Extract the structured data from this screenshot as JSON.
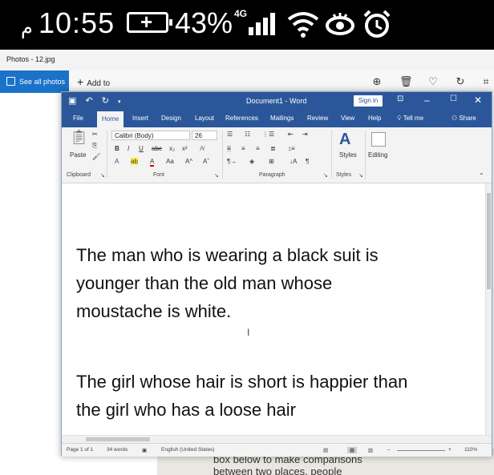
{
  "status_bar": {
    "ampm": "م",
    "time": "10:55",
    "battery_percent": "43%",
    "network": "4G"
  },
  "photos": {
    "title": "Photos - 12.jpg",
    "see_all_label": "See all photos",
    "add_to_label": "Add to"
  },
  "word": {
    "doc_title": "Document1 - Word",
    "sign_in": "Sign in",
    "tabs": [
      "File",
      "Home",
      "Insert",
      "Design",
      "Layout",
      "References",
      "Mailings",
      "Review",
      "View",
      "Help",
      "Tell me",
      "Share"
    ],
    "active_tab": "Home",
    "ribbon": {
      "paste_label": "Paste",
      "font_name": "Calibri (Body)",
      "font_size": "26",
      "styles_label": "Styles",
      "editing_label": "Editing",
      "groups": [
        "Clipboard",
        "Font",
        "Paragraph",
        "Styles"
      ]
    },
    "document": {
      "paragraph1": [
        "The man who is wearing a black suit is",
        "younger than the old man whose",
        "moustache is white."
      ],
      "paragraph2": [
        "The girl whose hair is short is happier than",
        "the girl who has a loose hair"
      ]
    },
    "statusbar": {
      "page": "Page 1 of 1",
      "words": "34 words",
      "language": "English (United States)",
      "zoom": "110%"
    }
  },
  "background": {
    "lines": [
      "box below to make comparisons",
      "between two places, people"
    ]
  },
  "colors": {
    "word_blue": "#2b579a",
    "photos_blue": "#1a73c8"
  }
}
